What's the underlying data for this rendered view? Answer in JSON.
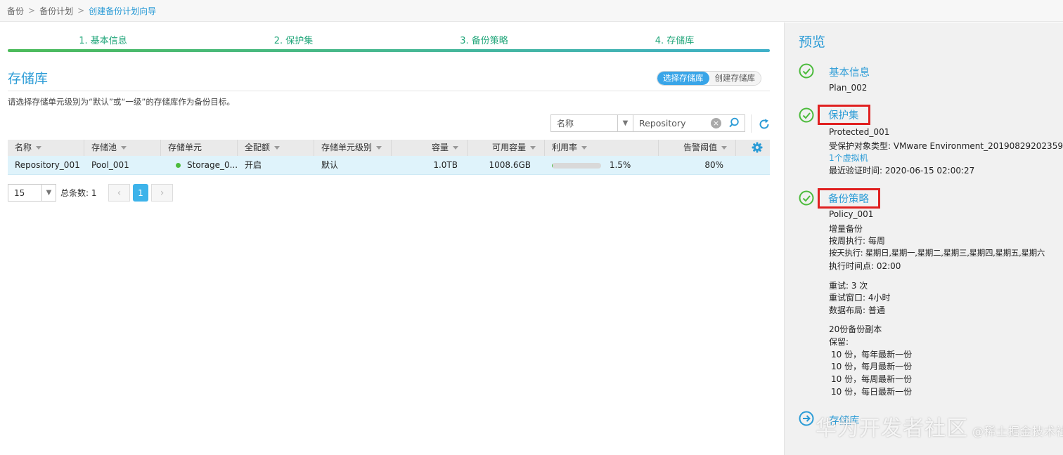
{
  "breadcrumb": {
    "items": [
      "备份",
      "备份计划",
      "创建备份计划向导"
    ],
    "separator": ">"
  },
  "steps": [
    "1. 基本信息",
    "2. 保护集",
    "3. 备份策略",
    "4. 存储库"
  ],
  "section": {
    "title": "存储库",
    "hint": "请选择存储单元级别为“默认”或“一级”的存储库作为备份目标。"
  },
  "segment": {
    "active": "选择存储库",
    "inactive": "创建存储库"
  },
  "filter": {
    "field": "名称",
    "value": "Repository"
  },
  "table": {
    "headers": [
      "名称",
      "存储池",
      "存储单元",
      "全配额",
      "存储单元级别",
      "容量",
      "可用容量",
      "利用率",
      "告警阈值"
    ],
    "row": {
      "name": "Repository_001",
      "pool": "Pool_001",
      "unit": "Storage_0...",
      "quota": "开启",
      "level": "默认",
      "capacity": "1.0TB",
      "available": "1008.6GB",
      "usage": "1.5%",
      "usage_fraction": 0.015,
      "threshold": "80%"
    }
  },
  "pager": {
    "size": "15",
    "total": "总条数: 1",
    "page": "1",
    "prev": "‹",
    "next": "›"
  },
  "preview": {
    "title": "预览",
    "basic": {
      "title": "基本信息",
      "name": "Plan_002"
    },
    "protection": {
      "title": "保护集",
      "name": "Protected_001",
      "type": "受保护对象类型: VMware Environment_20190829202359",
      "vm_link": "1个虚拟机",
      "last_verify": "最近验证时间: 2020-06-15 02:00:27"
    },
    "policy": {
      "title": "备份策略",
      "lines": [
        "Policy_001",
        "增量备份",
        "按周执行: 每周",
        "按天执行: 星期日,星期一,星期二,星期三,星期四,星期五,星期六",
        "执行时间点: 02:00"
      ],
      "retry": [
        "重试: 3 次",
        "重试窗口: 4小时",
        "数据布局: 普通"
      ],
      "copies": [
        "20份备份副本",
        "保留:",
        " 10 份，每年最新一份",
        " 10 份，每月最新一份",
        " 10 份，每周最新一份",
        " 10 份，每日最新一份"
      ]
    },
    "repo": {
      "title": "存储库"
    }
  },
  "watermark": {
    "main": "华为开发者社区",
    "sub": "@稀土掘金技术社区"
  },
  "colors": {
    "accent": "#2a9bd6",
    "green": "#4cbb3c",
    "highlight": "#e02020"
  }
}
